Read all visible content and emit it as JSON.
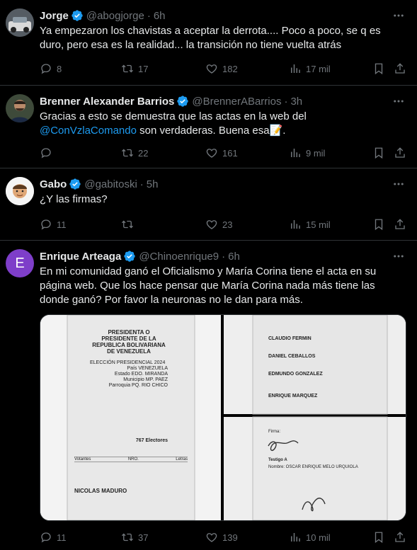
{
  "colors": {
    "background": "#000000",
    "text": "#e7e9ea",
    "muted": "#71767b",
    "accent": "#1d9bf0",
    "verified": "#1d9bf0",
    "divider": "#2f3336"
  },
  "tweets": [
    {
      "name": "Jorge",
      "handle": "@abogjorge",
      "time": "6h",
      "text": "Ya empezaron los chavistas a aceptar la derrota.... Poco a poco, se q es duro, pero esa es la realidad... la transición no tiene vuelta atrás",
      "replies": "8",
      "retweets": "17",
      "likes": "182",
      "views": "17 mil"
    },
    {
      "name": "Brenner Alexander Barrios",
      "handle": "@BrennerABarrios",
      "time": "3h",
      "text_before": "Gracias a esto se demuestra que las actas en la web del ",
      "mention": "@ConVzlaComando",
      "text_after": " son verdaderas. Buena esa",
      "emoji": "📝",
      "text_end": ".",
      "replies": "",
      "retweets": "22",
      "likes": "161",
      "views": "9 mil"
    },
    {
      "name": "Gabo",
      "handle": "@gabitoski",
      "time": "5h",
      "text": "¿Y las firmas?",
      "replies": "11",
      "retweets": "",
      "likes": "23",
      "views": "15 mil"
    },
    {
      "name": "Enrique Arteaga",
      "handle": "@Chinoenrique9",
      "time": "6h",
      "avatar_letter": "E",
      "text": "En mi comunidad ganó el Oficialismo y María Corina tiene el acta en su página web. Que los hace pensar que María Corina nada más tiene las donde ganó? Por favor la neuronas no le dan para más.",
      "replies": "11",
      "retweets": "37",
      "likes": "139",
      "views": "10 mil"
    }
  ],
  "acta": {
    "heading": "PRESIDENTA O PRESIDENTE DE LA REPUBLICA BOLIVARIANA DE VENEZUELA",
    "election": "ELECCIÓN PRESIDENCIAL 2024",
    "country": "País VENEZUELA",
    "state": "Estado EDO. MIRANDA",
    "municipality": "Municipio MP. PAEZ",
    "parish": "Parroquia PQ. RIO CHICO",
    "votos_label": "Votantes",
    "nro_label": "NRO.",
    "letras_label": "Letras",
    "candidate1": "NICOLAS MADURO",
    "electores": "767 Electores",
    "candidate_fermin": "CLAUDIO FERMIN",
    "candidate_ceballos": "DANIEL CEBALLOS",
    "candidate_gonzalez": "EDMUNDO GONZALEZ",
    "candidate_marquez": "ENRIQUE MARQUEZ",
    "firma_label": "Firma:",
    "testigo_label": "Testigo A",
    "testigo_name": "Nombre: OSCAR ENRIQUE MELO URQUIOLA"
  }
}
